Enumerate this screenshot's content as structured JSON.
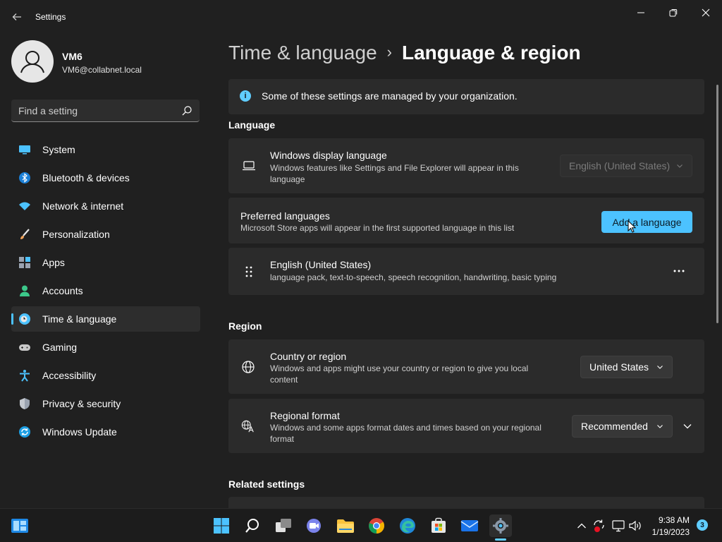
{
  "window": {
    "title": "Settings"
  },
  "user": {
    "name": "VM6",
    "email": "VM6@collabnet.local"
  },
  "search": {
    "placeholder": "Find a setting"
  },
  "sidebar": {
    "items": [
      {
        "label": "System",
        "icon": "monitor-icon"
      },
      {
        "label": "Bluetooth & devices",
        "icon": "bluetooth-icon"
      },
      {
        "label": "Network & internet",
        "icon": "wifi-icon"
      },
      {
        "label": "Personalization",
        "icon": "brush-icon"
      },
      {
        "label": "Apps",
        "icon": "apps-icon"
      },
      {
        "label": "Accounts",
        "icon": "person-icon"
      },
      {
        "label": "Time & language",
        "icon": "clock-globe-icon",
        "active": true
      },
      {
        "label": "Gaming",
        "icon": "gamepad-icon"
      },
      {
        "label": "Accessibility",
        "icon": "accessibility-icon"
      },
      {
        "label": "Privacy & security",
        "icon": "shield-icon"
      },
      {
        "label": "Windows Update",
        "icon": "update-icon"
      }
    ]
  },
  "breadcrumb": {
    "parent": "Time & language",
    "current": "Language & region"
  },
  "info_bar": {
    "text": "Some of these settings are managed by your organization."
  },
  "language_section": {
    "title": "Language",
    "display_language": {
      "title": "Windows display language",
      "desc": "Windows features like Settings and File Explorer will appear in this language",
      "value": "English (United States)"
    },
    "preferred": {
      "title": "Preferred languages",
      "desc": "Microsoft Store apps will appear in the first supported language in this list",
      "button": "Add a language"
    },
    "installed": {
      "title": "English (United States)",
      "desc": "language pack, text-to-speech, speech recognition, handwriting, basic typing"
    }
  },
  "region_section": {
    "title": "Region",
    "country": {
      "title": "Country or region",
      "desc": "Windows and apps might use your country or region to give you local content",
      "value": "United States"
    },
    "format": {
      "title": "Regional format",
      "desc": "Windows and some apps format dates and times based on your regional format",
      "value": "Recommended"
    }
  },
  "related": {
    "title": "Related settings"
  },
  "taskbar": {
    "time": "9:38 AM",
    "date": "1/19/2023",
    "notification_count": "3"
  },
  "colors": {
    "accent": "#4cc2ff",
    "background": "#202020",
    "card": "#2b2b2b"
  }
}
